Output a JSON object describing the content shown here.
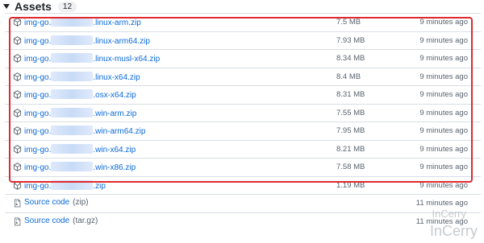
{
  "assets": {
    "title": "Assets",
    "count": "12",
    "rows": [
      {
        "name_prefix": "img-go.",
        "name_suffix": ".linux-arm.zip",
        "size": "7.5 MB",
        "time": "9 minutes ago"
      },
      {
        "name_prefix": "img-go.",
        "name_suffix": ".linux-arm64.zip",
        "size": "7.93 MB",
        "time": "9 minutes ago"
      },
      {
        "name_prefix": "img-go.",
        "name_suffix": ".linux-musl-x64.zip",
        "size": "8.34 MB",
        "time": "9 minutes ago"
      },
      {
        "name_prefix": "img-go.",
        "name_suffix": ".linux-x64.zip",
        "size": "8.4 MB",
        "time": "9 minutes ago"
      },
      {
        "name_prefix": "img-go.",
        "name_suffix": ".osx-x64.zip",
        "size": "8.31 MB",
        "time": "9 minutes ago"
      },
      {
        "name_prefix": "img-go.",
        "name_suffix": ".win-arm.zip",
        "size": "7.55 MB",
        "time": "9 minutes ago"
      },
      {
        "name_prefix": "img-go.",
        "name_suffix": ".win-arm64.zip",
        "size": "7.95 MB",
        "time": "9 minutes ago"
      },
      {
        "name_prefix": "img-go.",
        "name_suffix": ".win-x64.zip",
        "size": "8.21 MB",
        "time": "9 minutes ago"
      },
      {
        "name_prefix": "img-go.",
        "name_suffix": ".win-x86.zip",
        "size": "7.58 MB",
        "time": "9 minutes ago"
      },
      {
        "name_prefix": "img-go.",
        "name_suffix": ".zip",
        "size": "1.19 MB",
        "time": "9 minutes ago"
      }
    ],
    "source_rows": [
      {
        "label": "Source code",
        "format": "(zip)",
        "time": "11 minutes ago"
      },
      {
        "label": "Source code",
        "format": "(tar.gz)",
        "time": "11 minutes ago"
      }
    ]
  },
  "watermark": {
    "line1": "InCerry",
    "line2": "InCerry"
  },
  "colors": {
    "link": "#0969da",
    "highlight": "#e1282d",
    "muted": "#59636e"
  }
}
